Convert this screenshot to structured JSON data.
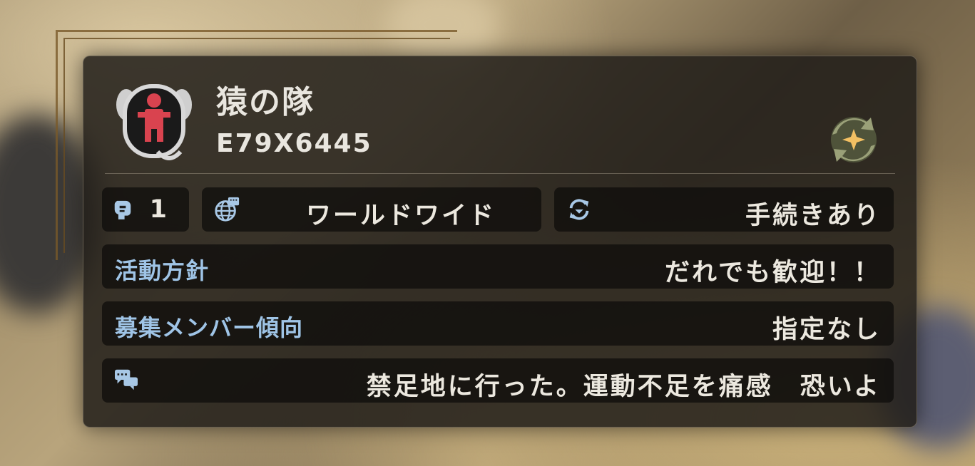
{
  "team": {
    "name": "猿の隊",
    "id": "E79X6445"
  },
  "stats": {
    "members": "1",
    "region": "ワールドワイド",
    "join_type": "手続きあり"
  },
  "policy": {
    "label": "活動方針",
    "value": "だれでも歓迎！！"
  },
  "recruit": {
    "label": "募集メンバー傾向",
    "value": "指定なし"
  },
  "comment": {
    "text": "禁足地に行った。運動不足を痛感　恐いよ"
  },
  "icons": {
    "avatar": "palico-team-emblem-icon",
    "rank": "rank-emblem-icon",
    "members": "member-head-icon",
    "region": "globe-icon",
    "join": "refresh-arrows-icon",
    "comment": "chat-bubbles-icon"
  },
  "colors": {
    "label_blue": "#9fc4e6",
    "text": "#ece8df",
    "emblem_red": "#d9434f"
  }
}
